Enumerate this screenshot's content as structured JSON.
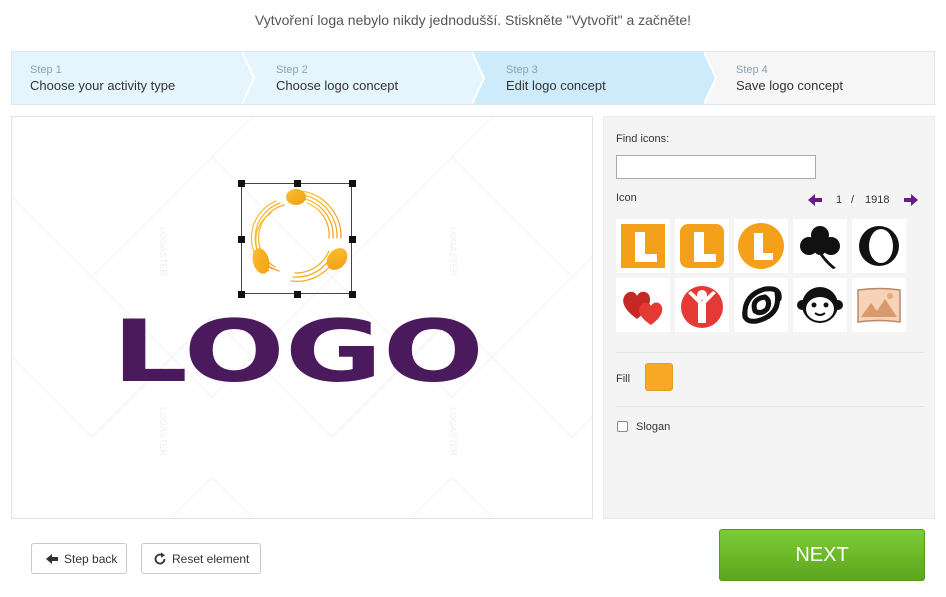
{
  "tagline": "Vytvoření loga nebylo nikdy jednodušší. Stiskněte \"Vytvořit\" a začněte!",
  "steps": [
    {
      "num": "Step 1",
      "title": "Choose your activity type",
      "state": "done"
    },
    {
      "num": "Step 2",
      "title": "Choose logo concept",
      "state": "done"
    },
    {
      "num": "Step 3",
      "title": "Edit logo concept",
      "state": "active"
    },
    {
      "num": "Step 4",
      "title": "Save logo concept",
      "state": "upcoming"
    }
  ],
  "canvas": {
    "logo_text": "LOGO",
    "logo_text_color": "#4b1a5c",
    "icon_color": "#f5a623",
    "watermark": "LOGASTER"
  },
  "panel": {
    "find_label": "Find icons:",
    "find_value": "",
    "find_placeholder": "",
    "icon_label": "Icon",
    "pager": {
      "current": "1",
      "separator": "/",
      "total": "1918"
    },
    "icons": [
      "letter-l-square-orange-icon",
      "letter-l-rounded-orange-icon",
      "letter-l-circle-orange-icon",
      "clover-icon",
      "ring-icon",
      "hearts-icon",
      "person-arms-up-icon",
      "swirl-icon",
      "monkey-face-icon",
      "landscape-picture-icon"
    ],
    "fill_label": "Fill",
    "fill_color": "#f9a825",
    "slogan_label": "Slogan",
    "slogan_checked": false
  },
  "buttons": {
    "step_back": "Step back",
    "reset": "Reset element",
    "next": "NEXT"
  },
  "colors": {
    "accent_purple": "#6a1b8a",
    "next_green": "#6bbb2a"
  }
}
